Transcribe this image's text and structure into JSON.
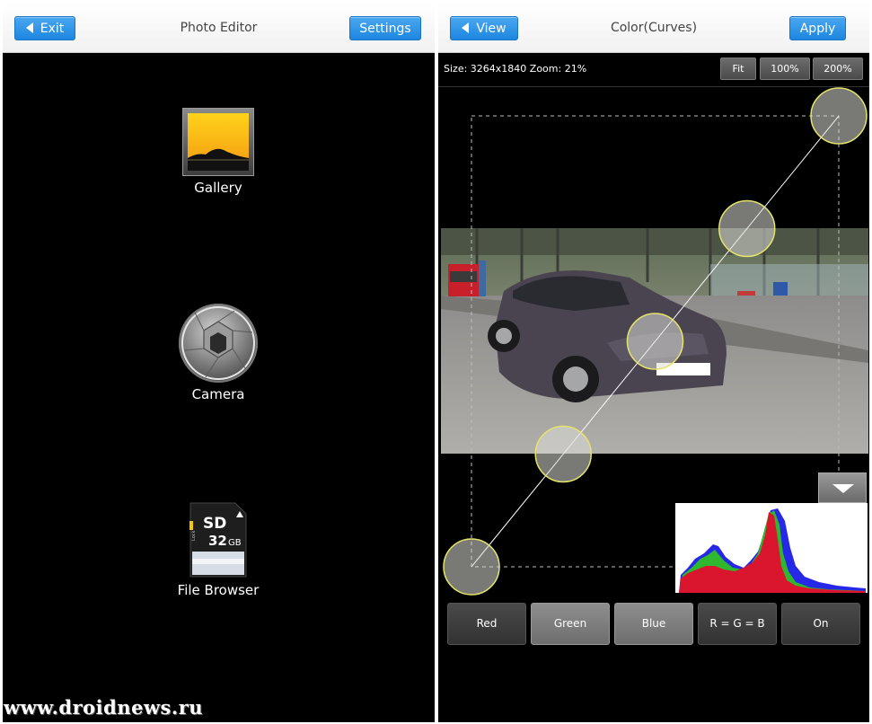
{
  "left_screen": {
    "title": "Photo Editor",
    "exit_label": "Exit",
    "settings_label": "Settings",
    "launchers": [
      {
        "label": "Gallery",
        "icon": "gallery-icon"
      },
      {
        "label": "Camera",
        "icon": "camera-icon"
      },
      {
        "label": "File Browser",
        "icon": "sd-card-icon"
      }
    ],
    "sd_card": {
      "brand": "SD",
      "capacity": "32",
      "unit": "GB",
      "lock_text": "Lock"
    }
  },
  "watermark": "www.droidnews.ru",
  "right_screen": {
    "title": "Color(Curves)",
    "view_label": "View",
    "apply_label": "Apply",
    "info_text": "Size: 3264x1840 Zoom: 21%",
    "zoom_buttons": [
      "Fit",
      "100%",
      "200%"
    ],
    "channel_buttons": [
      "Red",
      "Green",
      "Blue",
      "R = G = B",
      "On"
    ],
    "curve_point_count": 5,
    "histogram_colors": {
      "red": "#d9162e",
      "green": "#2fb82f",
      "blue": "#2727e8"
    },
    "accent_color": "#1d86e0",
    "handle_color": "#e4e36a"
  }
}
